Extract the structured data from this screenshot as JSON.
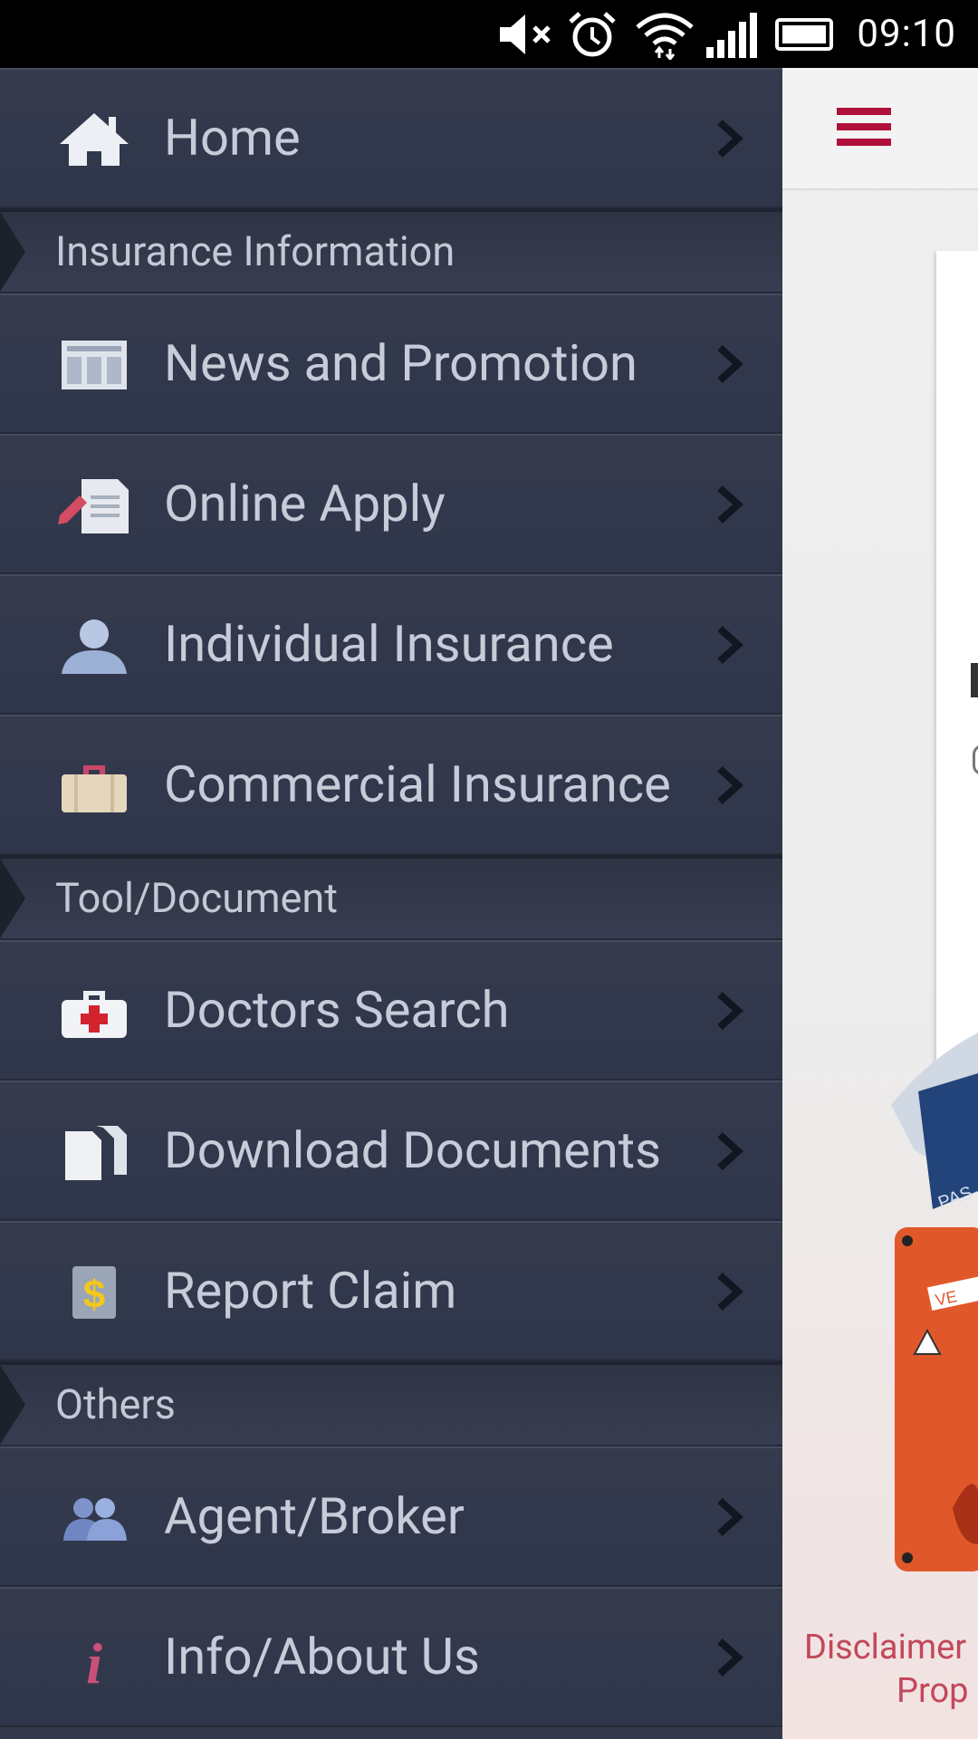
{
  "status_bar": {
    "time": "09:10",
    "icons": [
      "mute-icon",
      "alarm-icon",
      "wifi-icon",
      "signal-icon",
      "battery-icon"
    ]
  },
  "drawer": {
    "items": [
      {
        "type": "item",
        "label": "Home",
        "icon": "home-icon"
      },
      {
        "type": "section",
        "label": "Insurance Information"
      },
      {
        "type": "item",
        "label": "News and Promotion",
        "icon": "newspaper-icon"
      },
      {
        "type": "item",
        "label": "Online Apply",
        "icon": "document-pen-icon"
      },
      {
        "type": "item",
        "label": "Individual Insurance",
        "icon": "person-icon"
      },
      {
        "type": "item",
        "label": "Commercial Insurance",
        "icon": "briefcase-icon"
      },
      {
        "type": "section",
        "label": "Tool/Document"
      },
      {
        "type": "item",
        "label": "Doctors Search",
        "icon": "medical-kit-icon"
      },
      {
        "type": "item",
        "label": "Download Documents",
        "icon": "documents-icon"
      },
      {
        "type": "item",
        "label": "Report Claim",
        "icon": "dollar-document-icon"
      },
      {
        "type": "section",
        "label": "Others"
      },
      {
        "type": "item",
        "label": "Agent/Broker",
        "icon": "people-icon"
      },
      {
        "type": "item",
        "label": "Info/About Us",
        "icon": "info-icon"
      }
    ]
  },
  "main": {
    "menu_icon": "hamburger-menu-icon",
    "disclaimer_line1": "Disclaimer",
    "disclaimer_line2": "Prop"
  },
  "colors": {
    "drawer_bg": "#33394a",
    "accent": "#b0103a",
    "disclaimer": "#c2485a"
  }
}
